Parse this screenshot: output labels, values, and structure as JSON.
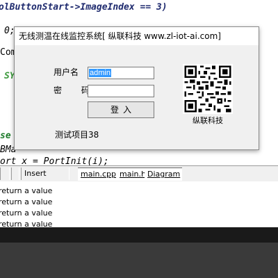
{
  "editor": {
    "lines": [
      "olButtonStart->ImageIndex == 3)",
      "0;",
      "Com",
      "SY",
      "se",
      "BMa",
      "ort x = PortInit(i);"
    ]
  },
  "ide_bar": {
    "insert_label": "Insert",
    "tabs": [
      "main.cpp",
      "main.h",
      "Diagram"
    ]
  },
  "output": {
    "lines": [
      "return a value",
      "return a value",
      "return a value",
      "return a value"
    ]
  },
  "dialog": {
    "title": "无线测温在线监控系统[ 纵联科技 www.zl-iot-ai.com]",
    "user_label": "用户名",
    "password_label": "密 码",
    "username_value": "admin",
    "login_button": "登入",
    "test_label": "测试项目38",
    "qr_caption": "纵联科技"
  }
}
